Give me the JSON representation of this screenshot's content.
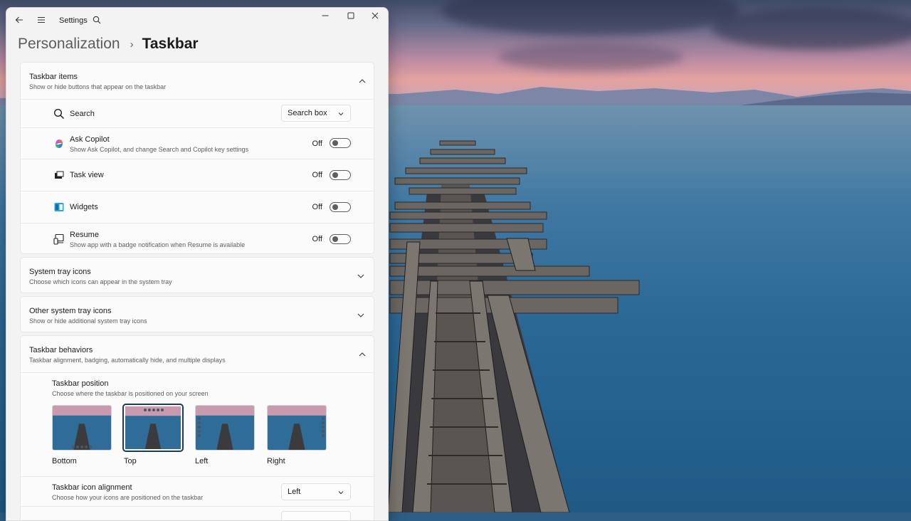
{
  "window": {
    "app_title": "Settings",
    "breadcrumb_parent": "Personalization",
    "breadcrumb_separator": "›",
    "breadcrumb_current": "Taskbar"
  },
  "taskbar_items": {
    "title": "Taskbar items",
    "subtitle": "Show or hide buttons that appear on the taskbar",
    "expanded": true,
    "rows": [
      {
        "label": "Search",
        "control": "dropdown",
        "value": "Search box",
        "icon": "search-icon"
      },
      {
        "label": "Ask Copilot",
        "subtitle": "Show Ask Copilot, and change Search and Copilot key settings",
        "control": "toggle",
        "state": "Off",
        "icon": "copilot-icon"
      },
      {
        "label": "Task view",
        "control": "toggle",
        "state": "Off",
        "icon": "task-view-icon"
      },
      {
        "label": "Widgets",
        "control": "toggle",
        "state": "Off",
        "icon": "widgets-icon"
      },
      {
        "label": "Resume",
        "subtitle": "Show app with a badge notification when Resume is available",
        "control": "toggle",
        "state": "Off",
        "icon": "resume-icon"
      }
    ]
  },
  "system_tray": {
    "title": "System tray icons",
    "subtitle": "Choose which icons can appear in the system tray",
    "expanded": false
  },
  "other_tray": {
    "title": "Other system tray icons",
    "subtitle": "Show or hide additional system tray icons",
    "expanded": false
  },
  "behaviors": {
    "title": "Taskbar behaviors",
    "subtitle": "Taskbar alignment, badging, automatically hide, and multiple displays",
    "expanded": true,
    "position": {
      "title": "Taskbar position",
      "subtitle": "Choose where the taskbar is positioned on your screen",
      "options": [
        "Bottom",
        "Top",
        "Left",
        "Right"
      ],
      "selected": "Top"
    },
    "alignment": {
      "title": "Taskbar icon alignment",
      "subtitle": "Choose how your icons are positioned on the taskbar",
      "value": "Left"
    }
  },
  "colors": {
    "accent": "#1c3a5a",
    "toggle_off": "#5f5f5f"
  }
}
